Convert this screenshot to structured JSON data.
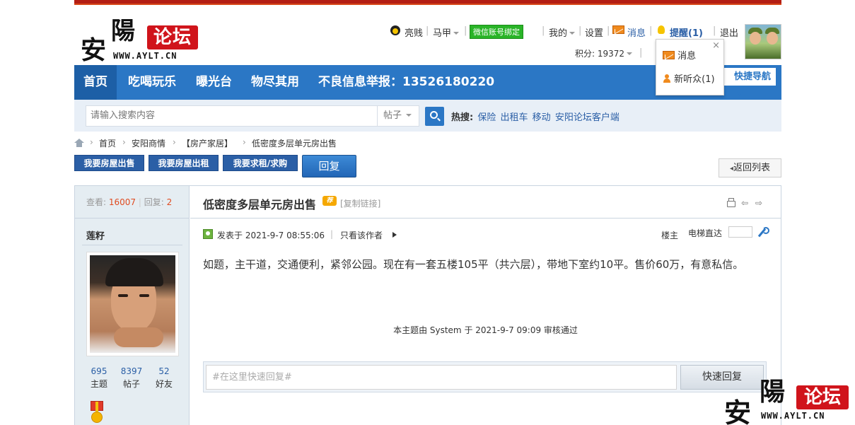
{
  "logo": {
    "char1": "安",
    "char2": "陽",
    "badge": "论坛",
    "url": "WWW.AYLT.CN"
  },
  "userbar": {
    "username": "亮贱",
    "majia": "马甲",
    "wechat_bind": "微信账号绑定",
    "mine": "我的",
    "settings": "设置",
    "messages": "消息",
    "reminders": "提醒(1)",
    "logout": "退出",
    "points": "积分: 19372"
  },
  "popup": {
    "close": "×",
    "item1": "消息",
    "item2": "新听众(1)"
  },
  "nav": {
    "items": [
      "首页",
      "吃喝玩乐",
      "曝光台",
      "物尽其用",
      "不良信息举报：13526180220"
    ],
    "quick_nav": "快捷导航"
  },
  "search": {
    "placeholder": "请输入搜索内容",
    "type": "帖子",
    "hot_label": "热搜:",
    "hot_links": [
      "保险",
      "出租车",
      "移动",
      "安阳论坛客户端"
    ]
  },
  "breadcrumb": [
    "首页",
    "安阳商情",
    "【房产家居】",
    "低密度多层单元房出售"
  ],
  "actions": {
    "btn1": "我要房屋出售",
    "btn2": "我要房屋出租",
    "btn3": "我要求租/求购",
    "reply": "回复",
    "back": "返回列表"
  },
  "thread": {
    "views_label": "查看:",
    "views": "16007",
    "replies_label": "回复:",
    "replies": "2",
    "title": "低密度多层单元房出售",
    "tag": "荐",
    "copy_link": "[复制链接]",
    "prev_icon": "⇦",
    "next_icon": "⇨"
  },
  "author": {
    "name": "莲籽",
    "stats": [
      {
        "value": "695",
        "label": "主题"
      },
      {
        "value": "8397",
        "label": "帖子"
      },
      {
        "value": "52",
        "label": "好友"
      }
    ]
  },
  "post": {
    "posted_at": "发表于 2021-9-7 08:55:06",
    "only_author": "只看该作者",
    "floor": "楼主",
    "elevator": "电梯直达",
    "content": "如题，主干道，交通便利，紧邻公园。现在有一套五楼105平（共六层），带地下室约10平。售价60万，有意私信。",
    "audit": "本主题由 System 于 2021-9-7 09:09 审核通过"
  },
  "quick_reply": {
    "placeholder": "#在这里快速回复#",
    "button": "快速回复"
  },
  "watermark": {
    "char1": "安",
    "char2": "陽",
    "badge": "论坛",
    "url": "WWW.AYLT.CN"
  }
}
